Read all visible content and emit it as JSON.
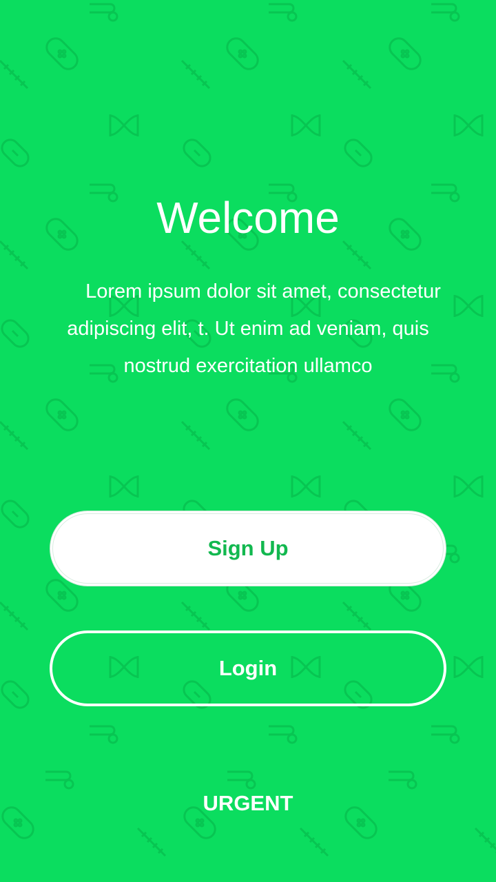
{
  "colors": {
    "background": "#0BDD5F",
    "pattern": "#08C552",
    "primary_text": "#FFFFFF",
    "signup_text": "#12B84F"
  },
  "background_pattern": {
    "icons": [
      "pill-icon",
      "bandage-icon",
      "syringe-icon",
      "dna-icon",
      "stethoscope-icon"
    ]
  },
  "welcome": {
    "title": "Welcome",
    "description": "Lorem ipsum dolor sit amet, consectetur adipiscing elit, t. Ut enim ad veniam, quis nostrud exercitation ullamco"
  },
  "actions": {
    "signup_label": "Sign Up",
    "login_label": "Login",
    "urgent_label": "URGENT"
  }
}
